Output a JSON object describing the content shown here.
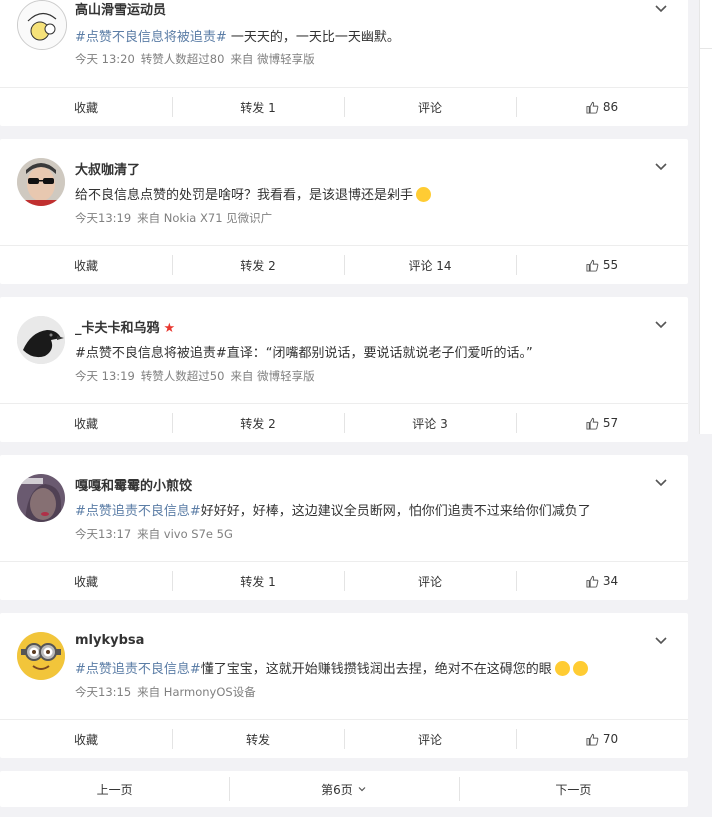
{
  "posts": [
    {
      "username": "高山滑雪运动员",
      "hashtag": "#点赞不良信息将被追责#",
      "text": " 一天天的，一天比一天幽默。",
      "time": "今天 13:20",
      "extra": "转赞人数超过80",
      "source": "来自 微博轻享版",
      "actions": {
        "favorite": "收藏",
        "repost": "转发 1",
        "comment": "评论",
        "like": "86"
      }
    },
    {
      "username": "大叔咖清了",
      "hashtag": "",
      "text": "给不良信息点赞的处罚是啥呀？我看看，是该退博还是剁手",
      "time": "今天13:19",
      "extra": "",
      "source": "来自 Nokia X71 见微识广",
      "actions": {
        "favorite": "收藏",
        "repost": "转发 2",
        "comment": "评论 14",
        "like": "55"
      }
    },
    {
      "username": "_卡夫卡和乌鸦",
      "hashtag": "#点赞不良信息将被追责#",
      "text": "直译：“闭嘴都别说话，要说话就说老子们爱听的话。”",
      "time": "今天 13:19",
      "extra": "转赞人数超过50",
      "source": "来自 微博轻享版",
      "actions": {
        "favorite": "收藏",
        "repost": "转发 2",
        "comment": "评论 3",
        "like": "57"
      }
    },
    {
      "username": "嘎嘎和霉霉的小煎饺",
      "hashtag": "#点赞追责不良信息#",
      "text": "好好好，好棒，这边建议全员断网，怕你们追责不过来给你们减负了",
      "time": "今天13:17",
      "extra": "",
      "source": "来自 vivo S7e 5G",
      "actions": {
        "favorite": "收藏",
        "repost": "转发 1",
        "comment": "评论",
        "like": "34"
      }
    },
    {
      "username": "mlykybsa",
      "hashtag": "#点赞追责不良信息#",
      "text": "懂了宝宝，这就开始赚钱攒钱润出去捏，绝对不在这碍您的眼",
      "time": "今天13:15",
      "extra": "",
      "source": "来自 HarmonyOS设备",
      "actions": {
        "favorite": "收藏",
        "repost": "转发",
        "comment": "评论",
        "like": "70"
      }
    }
  ],
  "pager": {
    "prev": "上一页",
    "current": "第6页",
    "next": "下一页"
  },
  "colors": {
    "hashtag": "#5b7da6",
    "badge": "#e8372f",
    "background": "#f2f2f5"
  }
}
